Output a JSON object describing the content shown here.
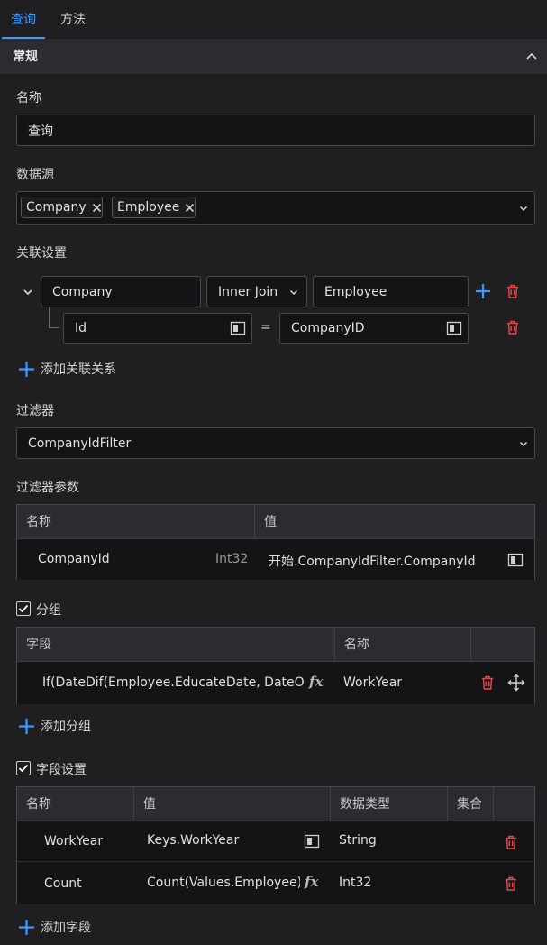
{
  "tabs": [
    {
      "label": "查询",
      "active": true
    },
    {
      "label": "方法",
      "active": false
    }
  ],
  "section": {
    "title": "常规",
    "icon": "chevron-up-icon"
  },
  "name_field": {
    "label": "名称",
    "value": "查询"
  },
  "datasource": {
    "label": "数据源",
    "chips": [
      "Company",
      "Employee"
    ],
    "icon": "chevron-down-icon"
  },
  "join": {
    "label": "关联设置",
    "left_table": "Company",
    "join_type": "Inner Join",
    "right_table": "Employee",
    "condition": {
      "left_field": "Id",
      "operator": "=",
      "right_field": "CompanyID"
    },
    "add_label": "添加关联关系"
  },
  "filter": {
    "label": "过滤器",
    "value": "CompanyIdFilter"
  },
  "filter_params": {
    "label": "过滤器参数",
    "columns": [
      "名称",
      "值"
    ],
    "rows": [
      {
        "name": "CompanyId",
        "type": "Int32",
        "value": "开始.CompanyIdFilter.CompanyId"
      }
    ]
  },
  "grouping": {
    "checkbox_label": "分组",
    "checked": true,
    "columns": [
      "字段",
      "名称"
    ],
    "rows": [
      {
        "field": "If(DateDif(Employee.EducateDate, DateOnly",
        "name": "WorkYear"
      }
    ],
    "add_label": "添加分组"
  },
  "fields": {
    "checkbox_label": "字段设置",
    "checked": true,
    "columns": [
      "名称",
      "值",
      "数据类型",
      "集合"
    ],
    "rows": [
      {
        "name": "WorkYear",
        "value": "Keys.WorkYear",
        "type": "String",
        "icon": "expand-icon"
      },
      {
        "name": "Count",
        "value": "Count(Values.Employee)",
        "type": "Int32",
        "icon": "fx-icon"
      }
    ],
    "add_label": "添加字段"
  },
  "colors": {
    "accent": "#3b9bff",
    "danger": "#e0464a",
    "background": "#1f1f22",
    "field_bg": "#141416"
  }
}
